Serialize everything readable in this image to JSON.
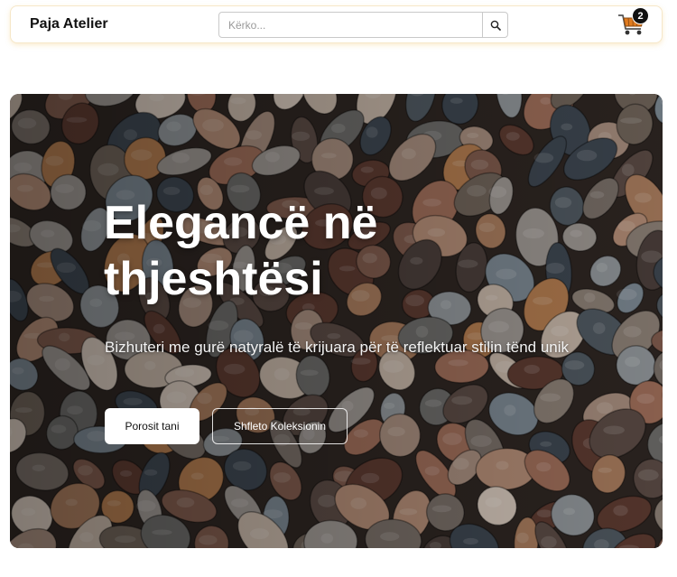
{
  "header": {
    "brand": "Paja Atelier",
    "search": {
      "placeholder": "Kërko...",
      "value": "",
      "button_icon": "search-icon"
    },
    "cart": {
      "icon": "shopping-cart-icon",
      "count": "2",
      "accent": "#e07b1f"
    }
  },
  "hero": {
    "title_line1": "Elegancë në",
    "title_line2": "thjeshtësi",
    "subtitle": "Bizhuteri me gurë natyralë të krijuara për të reflektuar stilin tënd unik",
    "primary_button": "Porosit tani",
    "secondary_button": "Shfleto Koleksionin",
    "background": "pebbles-photo"
  },
  "colors": {
    "header_border": "#f6e7c8",
    "text_dark": "#111111",
    "hero_text": "#ffffff"
  }
}
